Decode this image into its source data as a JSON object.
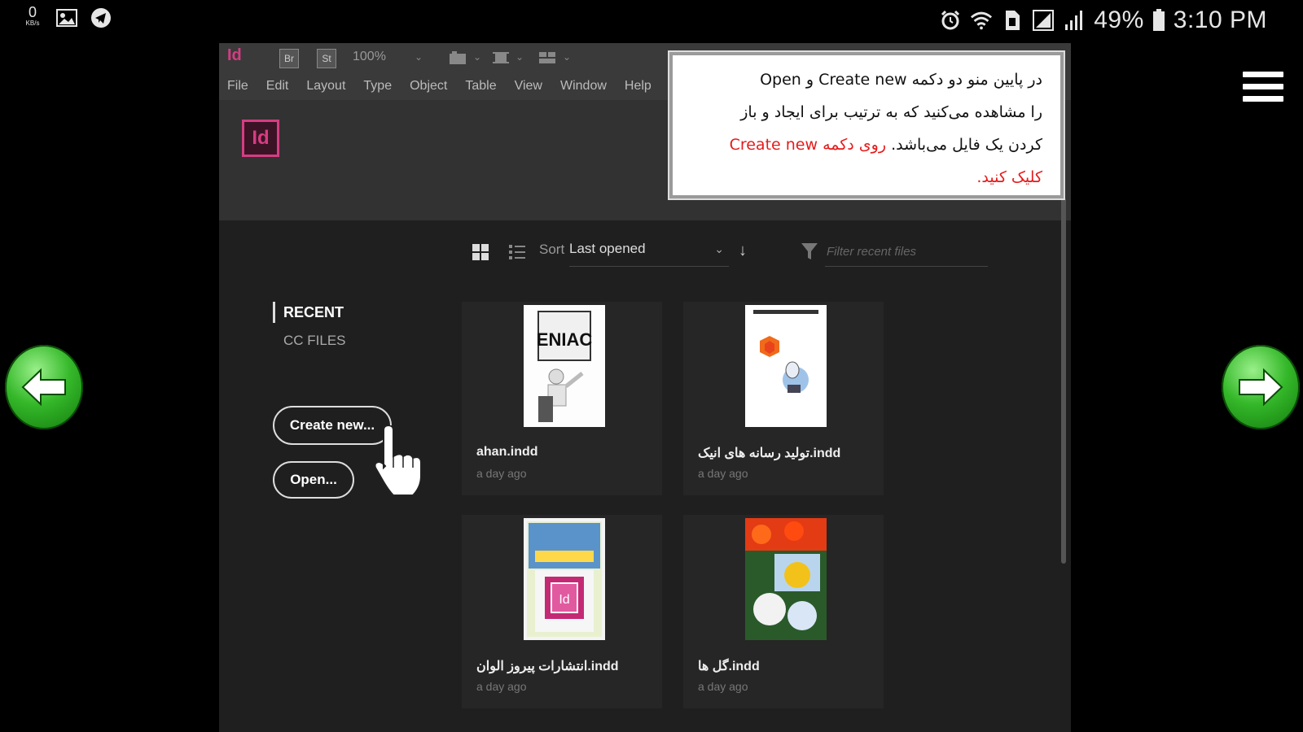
{
  "status_bar": {
    "left_icons": [
      "network-speed-icon",
      "image-icon",
      "telegram-icon"
    ],
    "network_speed": "0",
    "network_unit": "KB/s",
    "right_icons": [
      "alarm-icon",
      "wifi-icon",
      "sim-icon",
      "signal-icon",
      "signal-bars-icon",
      "battery-icon"
    ],
    "battery": "49%",
    "time": "3:10 PM"
  },
  "window": {
    "app_badge": "Id",
    "toolbar": {
      "br_button": "Br",
      "st_button": "St",
      "zoom": "100%"
    },
    "menu": [
      "File",
      "Edit",
      "Layout",
      "Type",
      "Object",
      "Table",
      "View",
      "Window",
      "Help"
    ]
  },
  "start_screen": {
    "logo": "Id",
    "sidebar": {
      "recent": "RECENT",
      "cc_files": "CC FILES",
      "create_button": "Create new...",
      "open_button": "Open..."
    },
    "sort": {
      "label": "Sort",
      "value": "Last opened"
    },
    "filter": {
      "placeholder": "Filter recent files"
    },
    "files": [
      {
        "name": "ahan.indd",
        "date": "a day ago"
      },
      {
        "name": "تولید رسانه های انیک.indd",
        "date": "a day ago"
      },
      {
        "name": "انتشارات پیروز الوان.indd",
        "date": "a day ago"
      },
      {
        "name": "گل ها.indd",
        "date": "a day ago"
      }
    ],
    "thumb_texts": {
      "eniac": "ENIAC"
    }
  },
  "tooltip": {
    "line1": "در پایین منو دو دکمه Create new و Open",
    "line2": "را مشاهده می‌کنید که به ترتیب برای ایجاد و باز",
    "line3_black": "کردن یک فایل می‌باشد.",
    "line3_red": "روی دکمه Create new",
    "line4_red": "کلیک کنید."
  },
  "colors": {
    "indesign_pink": "#d53d82",
    "arrow_green": "#35b82a",
    "tooltip_red": "#e51b1b"
  }
}
